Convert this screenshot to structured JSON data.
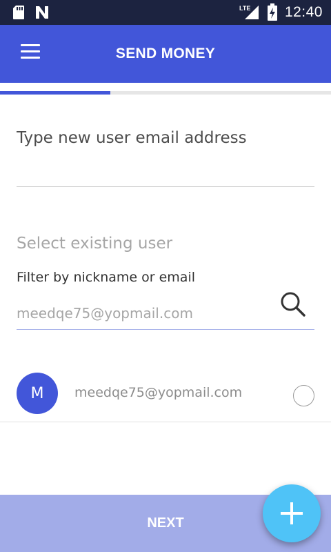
{
  "status_bar": {
    "time": "12:40",
    "network_label": "LTE",
    "icons": [
      "sd-card-icon",
      "n-logo-icon",
      "lte-signal-icon",
      "battery-charging-icon"
    ]
  },
  "app_bar": {
    "title": "SEND MONEY",
    "menu_icon": "hamburger-menu-icon"
  },
  "progress": {
    "step_fraction": 0.333
  },
  "new_user": {
    "placeholder": "Type new user email address",
    "value": ""
  },
  "existing_user": {
    "section_title": "Select existing user",
    "filter_label": "Filter by nickname or email",
    "filter_placeholder": "meedqe75@yopmail.com",
    "search_icon": "search-icon"
  },
  "users": [
    {
      "initial": "M",
      "email": "meedqe75@yopmail.com",
      "selected": false
    }
  ],
  "footer": {
    "next_label": "NEXT",
    "fab_icon": "plus-icon"
  },
  "colors": {
    "status_bar": "#1c2340",
    "primary": "#4256d9",
    "primary_light": "#a2ace8",
    "fab": "#4fc3f7"
  }
}
